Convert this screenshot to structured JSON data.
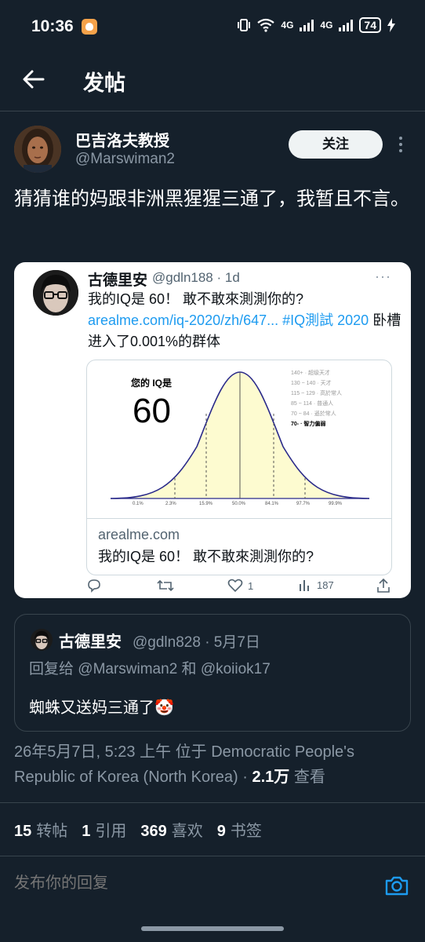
{
  "status_bar": {
    "time": "10:36",
    "network_1": "4G",
    "network_2": "4G",
    "battery": "74"
  },
  "header": {
    "title": "发帖"
  },
  "post": {
    "author_name": "巴吉洛夫教授",
    "author_handle": "@Marswiman2",
    "follow_label": "关注",
    "text": "猜猜谁的妈跟非洲黑猩猩三通了，我暂且不言。"
  },
  "embed": {
    "name": "古德里安",
    "handle_time": "@gdln188 · 1d",
    "more": "···",
    "text_line1": "我的IQ是 60！ 敢不敢來測測你的?",
    "text_link": "arealme.com/iq-2020/zh/647... #IQ測試 2020",
    "text_tail": " 卧槽进入了0.001%的群体",
    "graph": {
      "iq_label": "您的 IQ是",
      "iq_value": "60",
      "legend": [
        {
          "range": "140+",
          "label": "超级天才"
        },
        {
          "range": "130 ~ 140",
          "label": "天才"
        },
        {
          "range": "115 ~ 129",
          "label": "高於常人"
        },
        {
          "range": "85 ~ 114",
          "label": "普通人"
        },
        {
          "range": "70 ~ 84",
          "label": "遜於常人"
        },
        {
          "range": "70-",
          "label": "智力偏弱"
        }
      ],
      "percentiles": [
        "0.1%",
        "2.3%",
        "15.9%",
        "50.0%",
        "84.1%",
        "97.7%",
        "99.9%"
      ],
      "site": "arealme.com",
      "caption": "我的IQ是 60！ 敢不敢來測測你的?"
    },
    "actions": {
      "likes": "1",
      "views": "187"
    }
  },
  "quote": {
    "name": "古德里安",
    "meta": "@gdln828 · 5月7日",
    "reply_to": "回复给 @Marswiman2 和 @koiiok17",
    "text": "蜘蛛又送妈三通了🤡"
  },
  "timestamp": {
    "text": "26年5月7日, 5:23 上午 位于 Democratic People's Republic of Korea (North Korea) · ",
    "views_count": "2.1万",
    "views_label": " 查看"
  },
  "stats": [
    {
      "count": "15",
      "label": "转帖"
    },
    {
      "count": "1",
      "label": "引用"
    },
    {
      "count": "369",
      "label": "喜欢"
    },
    {
      "count": "9",
      "label": "书签"
    }
  ],
  "reply": {
    "placeholder": "发布你的回复"
  },
  "colors": {
    "accent": "#1d9bf0",
    "background": "#15202b"
  }
}
